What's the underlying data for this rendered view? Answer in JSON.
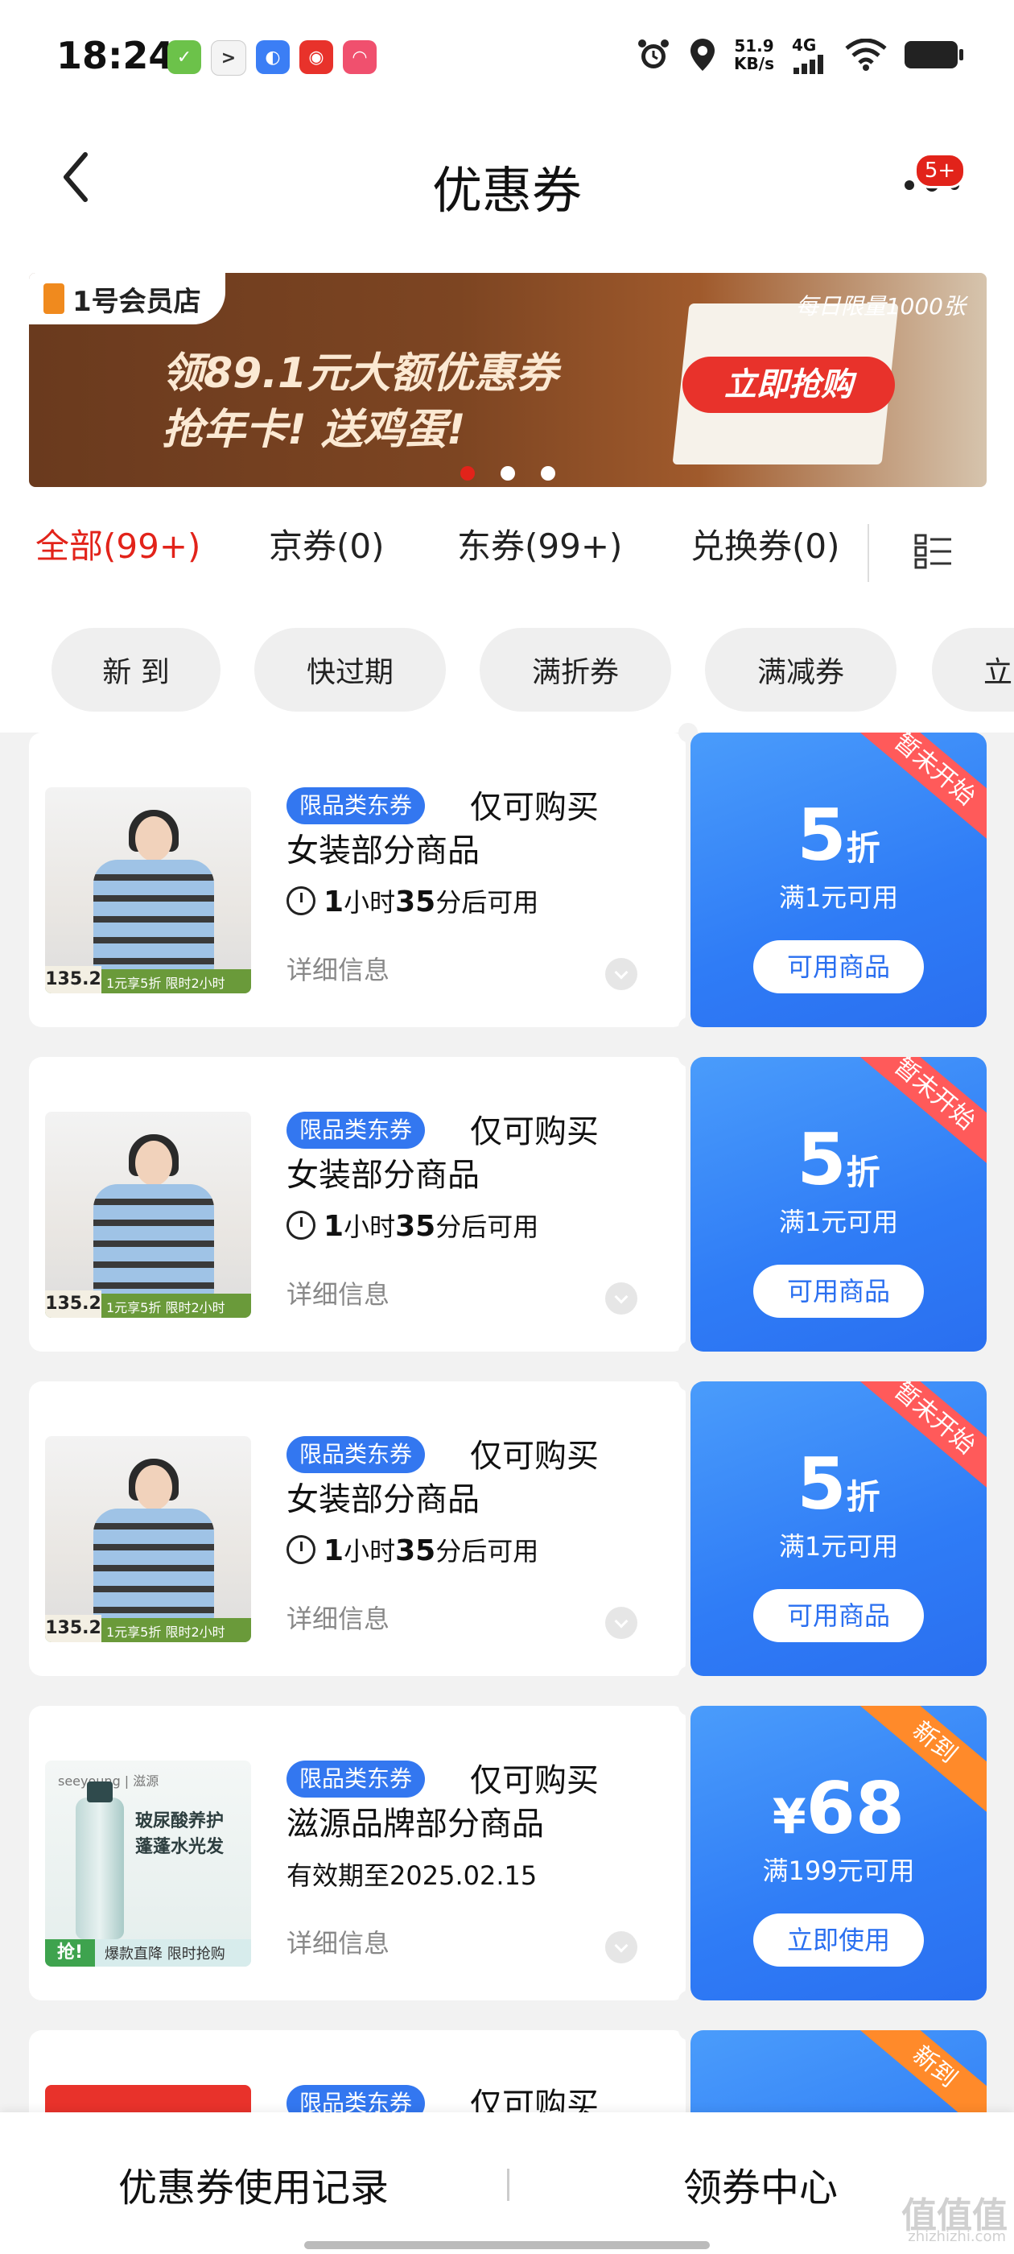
{
  "status_bar": {
    "time": "18:24",
    "speed_value": "51.9",
    "speed_unit": "KB/s",
    "network": "4G",
    "icons": [
      "app-icon-green",
      "app-icon-terminal",
      "app-icon-blue",
      "app-icon-red",
      "app-icon-pink",
      "alarm-icon",
      "location-icon",
      "signal-icon",
      "wifi-icon",
      "battery-icon"
    ]
  },
  "header": {
    "title": "优惠券",
    "badge": "5+"
  },
  "banner": {
    "logo": "1号会员店",
    "line1": "领89.1元大额优惠券",
    "line2": "抢年卡! 送鸡蛋!",
    "limit": "每日限量1000张",
    "cta": "立即抢购",
    "slides": 3,
    "active_slide": 1
  },
  "tabs": [
    {
      "label": "全部(99+)",
      "active": true
    },
    {
      "label": "京券(0)",
      "active": false
    },
    {
      "label": "东券(99+)",
      "active": false
    },
    {
      "label": "兑换券(0)",
      "active": false
    }
  ],
  "chips": [
    "新 到",
    "快过期",
    "满折券",
    "满减券",
    "立"
  ],
  "coupons": [
    {
      "tag": "限品类东券",
      "title1": "仅可购买",
      "title2": "女装部分商品",
      "time_num1": "1",
      "time_unit1": "小时",
      "time_num2": "35",
      "time_unit2": "分后可用",
      "detail": "详细信息",
      "ribbon": "暂未开始",
      "value": "5",
      "value_unit": "折",
      "condition": "满1元可用",
      "button": "可用商品",
      "thumb": {
        "price": "135.2",
        "promo": "1元享5折 限时2小时"
      }
    },
    {
      "tag": "限品类东券",
      "title1": "仅可购买",
      "title2": "女装部分商品",
      "time_num1": "1",
      "time_unit1": "小时",
      "time_num2": "35",
      "time_unit2": "分后可用",
      "detail": "详细信息",
      "ribbon": "暂未开始",
      "value": "5",
      "value_unit": "折",
      "condition": "满1元可用",
      "button": "可用商品",
      "thumb": {
        "price": "135.2",
        "promo": "1元享5折 限时2小时"
      }
    },
    {
      "tag": "限品类东券",
      "title1": "仅可购买",
      "title2": "女装部分商品",
      "time_num1": "1",
      "time_unit1": "小时",
      "time_num2": "35",
      "time_unit2": "分后可用",
      "detail": "详细信息",
      "ribbon": "暂未开始",
      "value": "5",
      "value_unit": "折",
      "condition": "满1元可用",
      "button": "可用商品",
      "thumb": {
        "price": "135.2",
        "promo": "1元享5折 限时2小时"
      }
    },
    {
      "tag": "限品类东券",
      "title1": "仅可购买",
      "title2": "滋源品牌部分商品",
      "validity": "有效期至2025.02.15",
      "detail": "详细信息",
      "ribbon": "新到",
      "currency": "¥",
      "value": "68",
      "condition": "满199元可用",
      "button": "立即使用",
      "thumb": {
        "brand": "seeyoung | 滋源",
        "text1": "玻尿酸养护",
        "text2": "蓬蓬水光发",
        "grab": "抢!",
        "promo": "爆款直降 限时抢购"
      }
    },
    {
      "tag": "限品类东券",
      "title1": "仅可购买",
      "ribbon": "新到"
    }
  ],
  "bottom_bar": {
    "left": "优惠券使用记录",
    "right": "领券中心"
  },
  "watermark": {
    "text": "值值值",
    "url": "zhizhizhi.com"
  }
}
